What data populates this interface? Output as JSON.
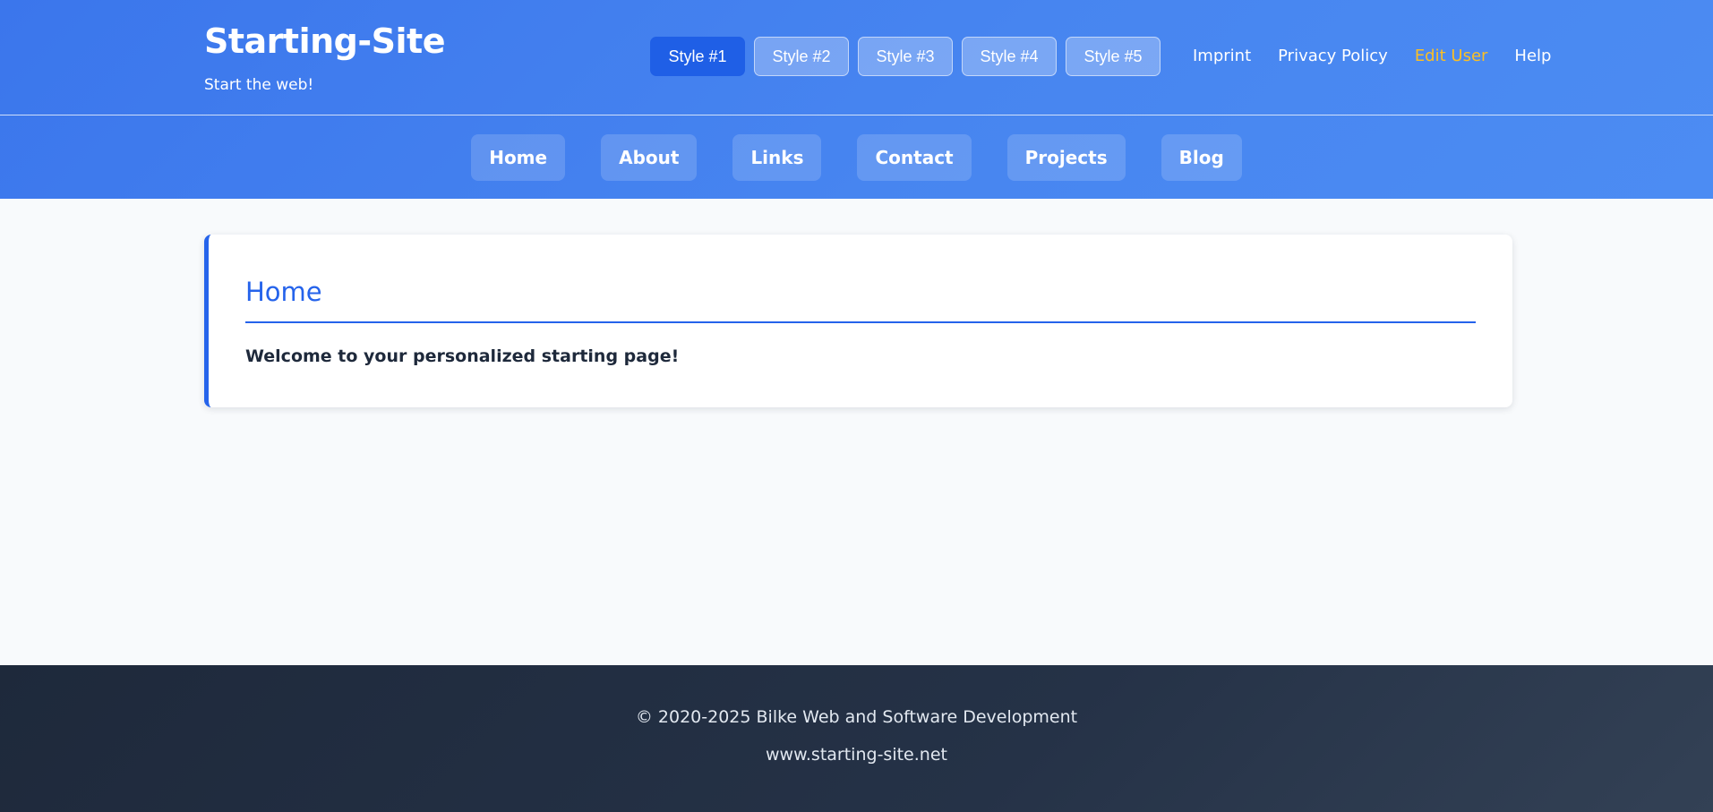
{
  "header": {
    "title": "Starting-Site",
    "tagline": "Start the web!",
    "style_buttons": [
      {
        "label": "Style #1",
        "active": true
      },
      {
        "label": "Style #2",
        "active": false
      },
      {
        "label": "Style #3",
        "active": false
      },
      {
        "label": "Style #4",
        "active": false
      },
      {
        "label": "Style #5",
        "active": false
      }
    ],
    "links": [
      {
        "label": "Imprint"
      },
      {
        "label": "Privacy Policy"
      },
      {
        "label": "Edit User"
      },
      {
        "label": "Help"
      }
    ]
  },
  "nav": {
    "items": [
      {
        "label": "Home"
      },
      {
        "label": "About"
      },
      {
        "label": "Links"
      },
      {
        "label": "Contact"
      },
      {
        "label": "Projects"
      },
      {
        "label": "Blog"
      }
    ]
  },
  "main": {
    "title": "Home",
    "text": "Welcome to your personalized starting page!"
  },
  "footer": {
    "copyright": "© 2020-2025 Bilke Web and Software Development",
    "url": "www.starting-site.net"
  },
  "colors": {
    "header_gradient_start": "#3b76ec",
    "header_gradient_end": "#4c8cf3",
    "active_style_button": "#1f5fe6",
    "accent": "#2563eb",
    "highlight_link": "#fbbf24",
    "page_background": "#f8fafc",
    "footer_background": "#1e293b"
  }
}
